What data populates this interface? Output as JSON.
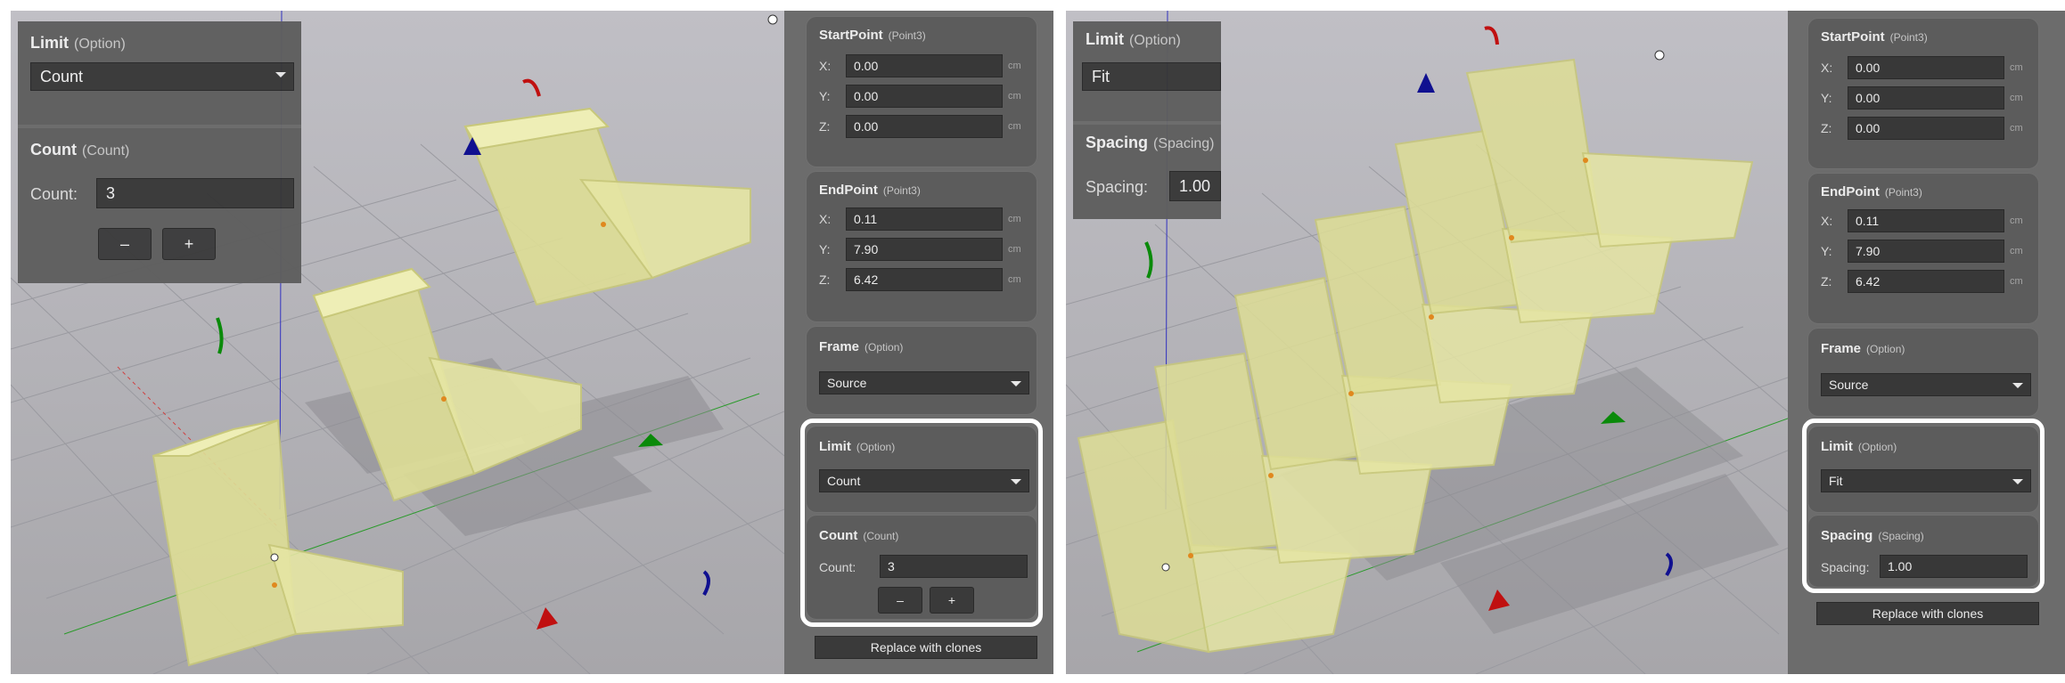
{
  "left": {
    "panel": {
      "start_point": {
        "title": "StartPoint",
        "type": "(Point3)",
        "x": "0.00",
        "y": "0.00",
        "z": "0.00"
      },
      "end_point": {
        "title": "EndPoint",
        "type": "(Point3)",
        "x": "0.11",
        "y": "7.90",
        "z": "6.42"
      },
      "frame": {
        "title": "Frame",
        "type": "(Option)",
        "value": "Source"
      },
      "limit": {
        "title": "Limit",
        "type": "(Option)",
        "value": "Count"
      },
      "count": {
        "title": "Count",
        "type": "(Count)",
        "label": "Count:",
        "value": "3",
        "minus": "–",
        "plus": "+"
      },
      "replace_label": "Replace with clones"
    },
    "overlay": {
      "limit_title": "Limit",
      "limit_type": "(Option)",
      "limit_value": "Count",
      "count_title": "Count",
      "count_type": "(Count)",
      "count_label": "Count:",
      "count_value": "3",
      "minus": "–",
      "plus": "+"
    }
  },
  "right": {
    "panel": {
      "start_point": {
        "title": "StartPoint",
        "type": "(Point3)",
        "x": "0.00",
        "y": "0.00",
        "z": "0.00"
      },
      "end_point": {
        "title": "EndPoint",
        "type": "(Point3)",
        "x": "0.11",
        "y": "7.90",
        "z": "6.42"
      },
      "frame": {
        "title": "Frame",
        "type": "(Option)",
        "value": "Source"
      },
      "limit": {
        "title": "Limit",
        "type": "(Option)",
        "value": "Fit"
      },
      "spacing": {
        "title": "Spacing",
        "type": "(Spacing)",
        "label": "Spacing:",
        "value": "1.00"
      },
      "replace_label": "Replace with clones"
    },
    "overlay": {
      "limit_title": "Limit",
      "limit_type": "(Option)",
      "limit_value": "Fit",
      "spacing_title": "Spacing",
      "spacing_type": "(Spacing)",
      "spacing_label": "Spacing:",
      "spacing_value": "1.00"
    }
  },
  "labels": {
    "x": "X:",
    "y": "Y:",
    "z": "Z:",
    "unit": "cm"
  },
  "colors": {
    "panel_bg": "#6c6c6c",
    "group_bg": "#5c5c5c",
    "input_bg": "#383838",
    "highlight": "#ffffff",
    "object_fill": "#e9e9a8",
    "object_stroke": "#d2d282",
    "pivot": "#e0881e",
    "axis_red": "#c00000",
    "axis_green": "#0a8a0a",
    "axis_blue": "#101080"
  }
}
